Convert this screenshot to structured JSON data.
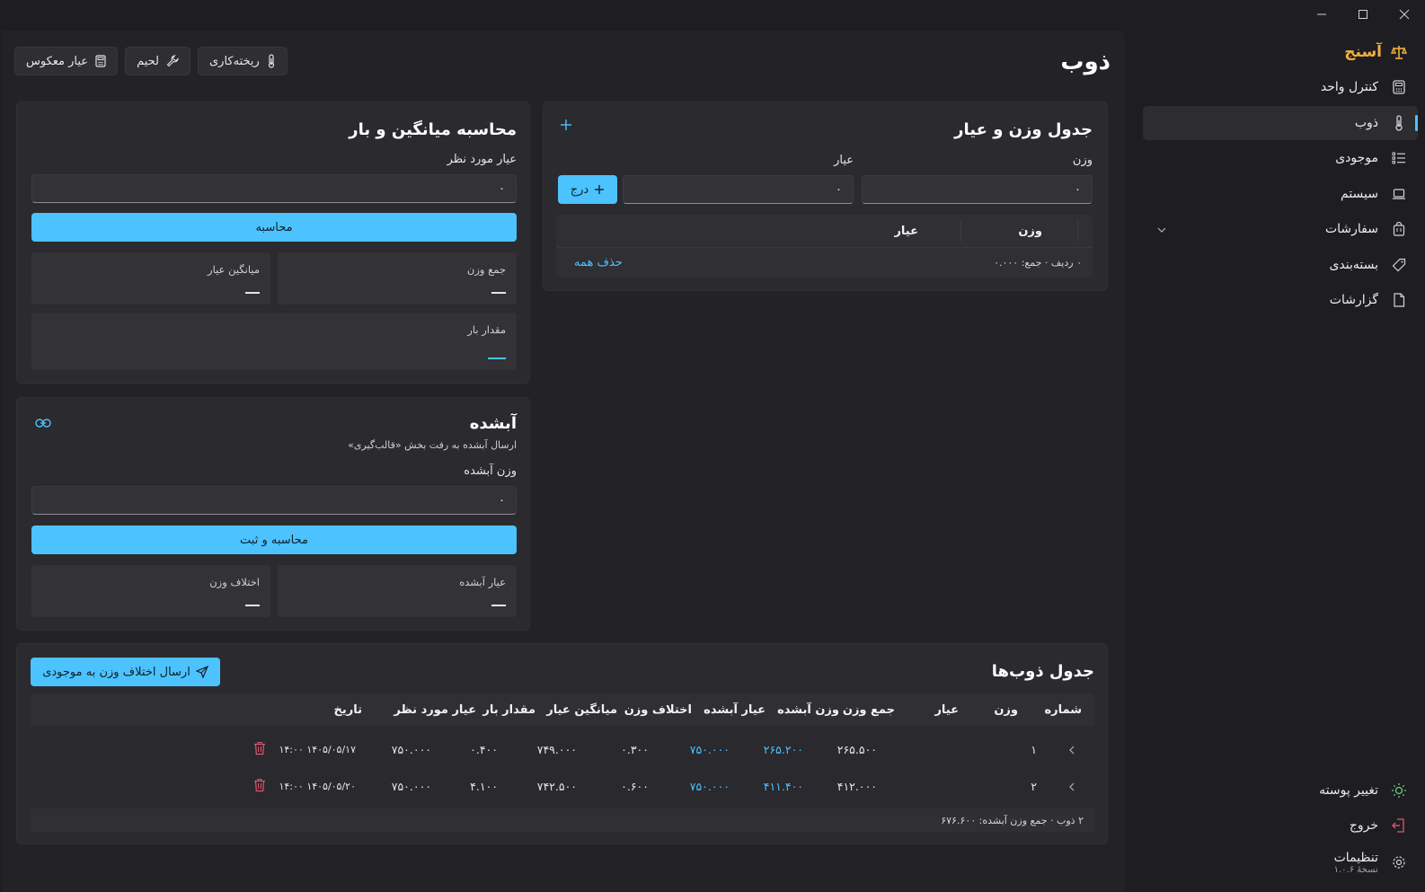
{
  "window": {
    "minimize": "—",
    "maximize": "☐",
    "close": "✕"
  },
  "brand": {
    "name": "آسنج",
    "color": "#f0b13a"
  },
  "nav": {
    "items": [
      {
        "label": "کنترل واحد",
        "icon": "calculator-icon"
      },
      {
        "label": "ذوب",
        "icon": "thermometer-icon",
        "active": true
      },
      {
        "label": "موجودی",
        "icon": "list-icon"
      },
      {
        "label": "سیستم",
        "icon": "laptop-icon"
      },
      {
        "label": "سفارشات",
        "icon": "bag-icon",
        "expandable": true
      },
      {
        "label": "بسته‌بندی",
        "icon": "tag-icon"
      },
      {
        "label": "گزارشات",
        "icon": "document-icon"
      }
    ],
    "bottom": {
      "theme": "تغییر پوسته",
      "logout": "خروج",
      "settings": "تنظیمات",
      "version": "نسخهٔ ۱.۰.۶"
    }
  },
  "page": {
    "title": "ذوب",
    "actions": {
      "casting": "ریخته‌کاری",
      "solder": "لحیم",
      "reverse_karat": "عیار معکوس"
    }
  },
  "weight_table": {
    "title": "جدول وزن و عیار",
    "weight_label": "وزن",
    "karat_label": "عیار",
    "weight_value": "۰",
    "karat_value": "۰",
    "insert_button": "درج",
    "col_weight": "وزن",
    "col_karat": "عیار",
    "summary": "۰ ردیف · جمع: ۰.۰۰۰",
    "clear_all": "حذف همه"
  },
  "average_calc": {
    "title": "محاسبه میانگین و بار",
    "target_label": "عیار مورد نظر",
    "target_value": "۰",
    "calc_button": "محاسبه",
    "sum_weight": "جمع وزن",
    "avg_karat": "میانگین عیار",
    "load_amount": "مقدار بار"
  },
  "melted": {
    "title": "آبشده",
    "subtitle": "ارسال آبشده به رفت بخش «قالب‌گیری»",
    "weight_label": "وزن آبشده",
    "weight_value": "۰",
    "calc_save_button": "محاسبه و ثبت",
    "melted_karat": "عیار آبشده",
    "weight_diff": "اختلاف وزن"
  },
  "melts_table": {
    "title": "جدول ذوب‌ها",
    "send_button": "ارسال اختلاف وزن به موجودی",
    "columns": [
      "شماره",
      "وزن",
      "عیار",
      "جمع وزن",
      "وزن آبشده",
      "عیار آبشده",
      "اختلاف وزن",
      "میانگین عیار",
      "مقدار بار",
      "عیار مورد نظر",
      "تاریخ"
    ],
    "rows": [
      {
        "num": "۱",
        "weight": "",
        "karat": "",
        "sum_weight": "۲۶۵.۵۰۰",
        "melted_weight": "۲۶۵.۲۰۰",
        "melted_karat": "۷۵۰.۰۰۰",
        "diff": "۰.۳۰۰",
        "avg_karat": "۷۴۹.۰۰۰",
        "load": "۰.۴۰۰",
        "target": "۷۵۰.۰۰۰",
        "date": "۱۴۰۵/۰۵/۱۷ ۱۴:۰۰"
      },
      {
        "num": "۲",
        "weight": "",
        "karat": "",
        "sum_weight": "۴۱۲.۰۰۰",
        "melted_weight": "۴۱۱.۴۰۰",
        "melted_karat": "۷۵۰.۰۰۰",
        "diff": "۰.۶۰۰",
        "avg_karat": "۷۴۲.۵۰۰",
        "load": "۴.۱۰۰",
        "target": "۷۵۰.۰۰۰",
        "date": "۱۴۰۵/۰۵/۲۰ ۱۴:۰۰"
      }
    ],
    "footer": "۲ ذوب · جمع وزن آبشده: ۶۷۶.۶۰۰"
  },
  "colors": {
    "accent": "#4cc2ff",
    "danger": "#e0566b",
    "brand": "#f0b13a"
  }
}
